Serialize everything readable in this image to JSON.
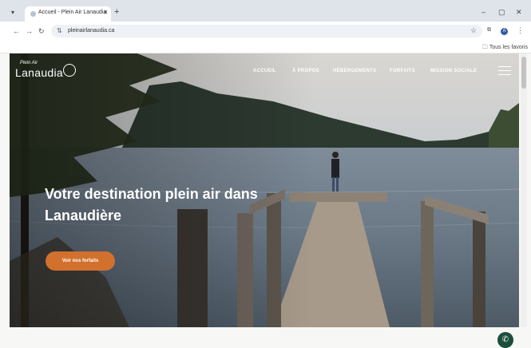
{
  "browser": {
    "tab_title": "Accueil - Plein Air Lanaudia",
    "tab_close": "×",
    "new_tab": "+",
    "tab_menu": "▾",
    "window_minimize": "–",
    "window_restore": "▢",
    "window_close": "✕",
    "back": "←",
    "forward": "→",
    "reload": "↻",
    "site_info": "⇅",
    "url": "pleinairlanaudia.ca",
    "bookmark_star": "☆",
    "extensions": "⧉",
    "profile_initial": "A",
    "menu": "⋮",
    "bookmarks_folder": "🗀 Tous les favoris"
  },
  "site": {
    "logo_small": "Plein Air",
    "logo_main": "Lanaudia",
    "nav": [
      "ACCUEIL",
      "À PROPOS",
      "HÉBERGEMENTS",
      "FORFAITS",
      "MISSION SOCIALE"
    ],
    "hero_title": "Votre destination plein air dans Lanaudière",
    "cta_label": "Voir nos forfaits",
    "chat_icon": "✆"
  },
  "colors": {
    "accent": "#d2702e",
    "chat": "#1c4e3a"
  }
}
